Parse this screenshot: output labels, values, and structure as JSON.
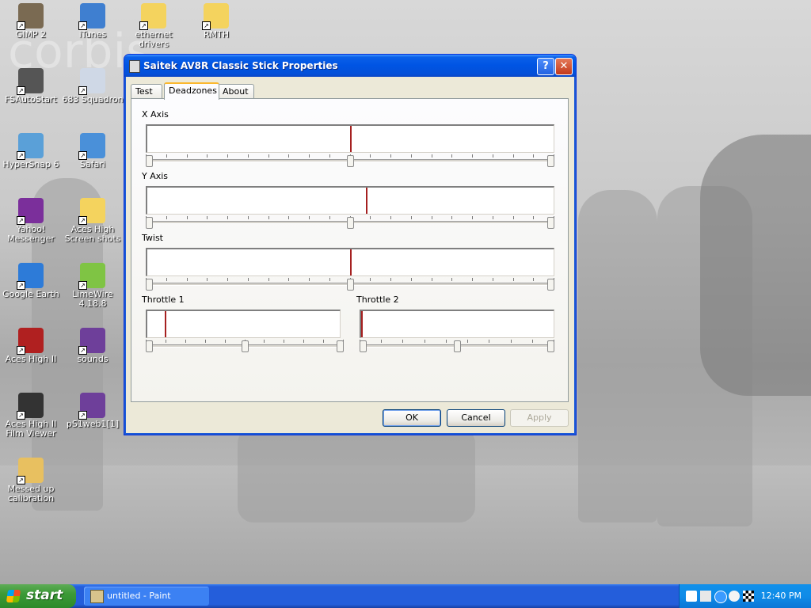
{
  "desktop": {
    "watermark": "corbis",
    "icons": [
      {
        "label": "GIMP 2",
        "icon": "gimp-icon"
      },
      {
        "label": "iTunes",
        "icon": "itunes-icon"
      },
      {
        "label": "ethernet drivers",
        "icon": "folder-icon"
      },
      {
        "label": "RMTH",
        "icon": "folder-icon"
      },
      {
        "label": "FSAutoStart",
        "icon": "airplane-icon"
      },
      {
        "label": "683 Squadron",
        "icon": "movie-icon"
      },
      {
        "label": "HyperSnap 6",
        "icon": "hypersnap-icon"
      },
      {
        "label": "Safari",
        "icon": "safari-compass-icon"
      },
      {
        "label": "Yahoo! Messenger",
        "icon": "yahoo-messenger-icon"
      },
      {
        "label": "Aces High Screen shots",
        "icon": "folder-icon"
      },
      {
        "label": "Google Earth",
        "icon": "google-earth-icon"
      },
      {
        "label": "LimeWire 4.18.8",
        "icon": "limewire-icon"
      },
      {
        "label": "Aces High II",
        "icon": "aces-high-icon"
      },
      {
        "label": "sounds",
        "icon": "winrar-archive-icon"
      },
      {
        "label": "Aces High II Film Viewer",
        "icon": "film-viewer-icon"
      },
      {
        "label": "pS1web1[1]",
        "icon": "winrar-archive-icon"
      },
      {
        "label": "Messed up calibration",
        "icon": "paint-image-icon"
      }
    ]
  },
  "window": {
    "title": "Saitek AV8R Classic Stick Properties",
    "help_label": "?",
    "close_label": "✕",
    "tabs": [
      "Test",
      "Deadzones",
      "About"
    ],
    "active_tab": "Deadzones",
    "axes": {
      "x_axis": {
        "label": "X Axis",
        "value": 0.5,
        "slider": 0.5
      },
      "y_axis": {
        "label": "Y Axis",
        "value": 0.54,
        "slider": 0.5
      },
      "twist": {
        "label": "Twist",
        "value": 0.5,
        "slider": 0.5
      },
      "throttle_1": {
        "label": "Throttle 1",
        "value": 0.09,
        "slider": 0.5
      },
      "throttle_2": {
        "label": "Throttle 2",
        "value": 0.0,
        "slider": 0.5
      }
    },
    "buttons": {
      "ok": "OK",
      "cancel": "Cancel",
      "apply": "Apply"
    }
  },
  "taskbar": {
    "start_label": "start",
    "task_item": "untitled - Paint",
    "clock": "12:40 PM"
  }
}
